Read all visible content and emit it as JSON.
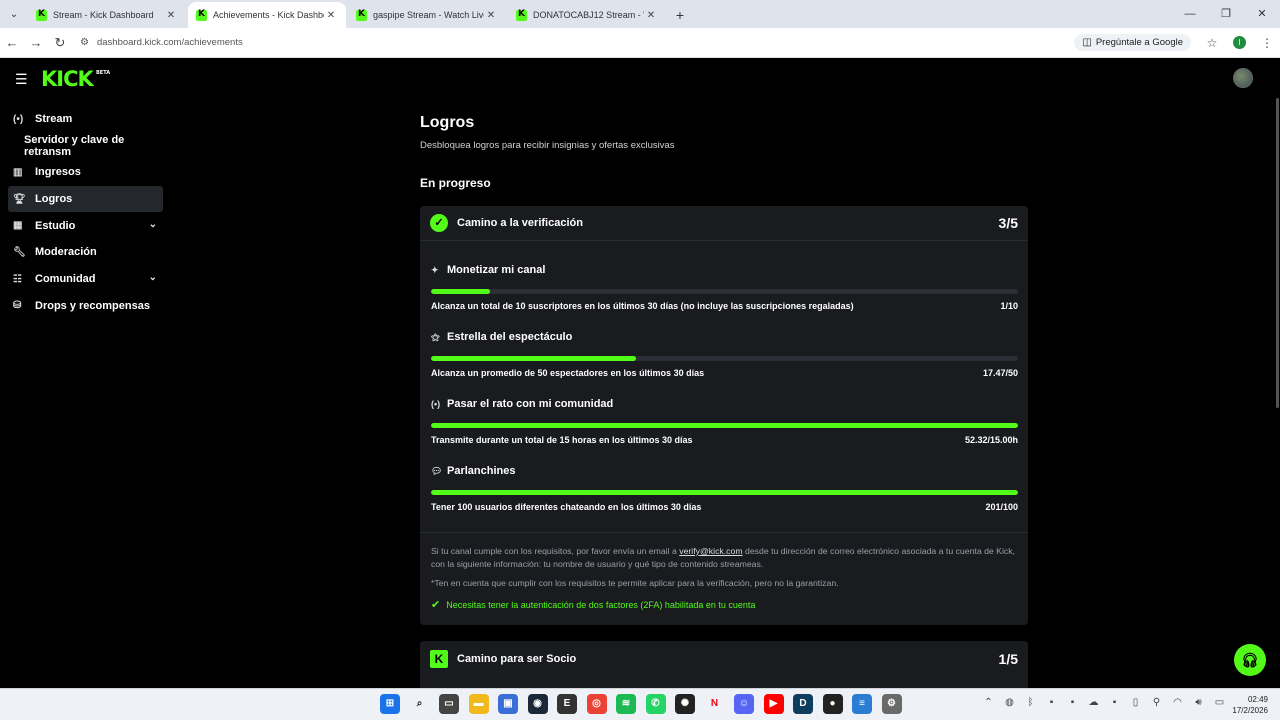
{
  "browser": {
    "tabs": [
      {
        "title": "Stream - Kick Dashboard",
        "active": false
      },
      {
        "title": "Achievements - Kick Dashboard",
        "active": true
      },
      {
        "title": "gaspipe Stream - Watch Live on",
        "active": false
      },
      {
        "title": "DONATOCABJ12 Stream - Watc",
        "active": false
      }
    ],
    "url": "dashboard.kick.com/achievements",
    "ask_google": "Pregúntale a Google",
    "profile_initial": "I"
  },
  "header": {
    "logo": "KICK",
    "logo_badge": "BETA"
  },
  "sidebar": {
    "items": [
      {
        "label": "Stream",
        "icon": "broadcast-icon"
      },
      {
        "label": "Servidor y clave de retransm",
        "icon": ""
      },
      {
        "label": "Ingresos",
        "icon": "chart-icon"
      },
      {
        "label": "Logros",
        "icon": "trophy-icon"
      },
      {
        "label": "Estudio",
        "icon": "studio-icon"
      },
      {
        "label": "Moderación",
        "icon": "wrench-icon"
      },
      {
        "label": "Comunidad",
        "icon": "community-icon"
      },
      {
        "label": "Drops y recompensas",
        "icon": "drops-icon"
      }
    ]
  },
  "main": {
    "title": "Logros",
    "subtitle": "Desbloquea logros para recibir insignias y ofertas exclusivas",
    "section": "En progreso",
    "verification": {
      "title": "Camino a la verificación",
      "count": "3/5",
      "achievements": [
        {
          "title": "Monetizar mi canal",
          "desc": "Alcanza un total de 10 suscriptores en los últimos 30 días (no incluye las suscripciones regaladas)",
          "value": "1/10",
          "progress": 0.1
        },
        {
          "title": "Estrella del espectáculo",
          "desc": "Alcanza un promedio de 50 espectadores en los últimos 30 días",
          "value": "17.47/50",
          "progress": 0.35
        },
        {
          "title": "Pasar el rato con mi comunidad",
          "desc": "Transmite durante un total de 15 horas en los últimos 30 días",
          "value": "52.32/15.00h",
          "progress": 1.0
        },
        {
          "title": "Parlanchines",
          "desc": "Tener 100 usuarios diferentes chateando en los últimos 30 días",
          "value": "201/100",
          "progress": 1.0
        }
      ],
      "note_pre": "Si tu canal cumple con los requisitos, por favor envía un email a",
      "note_email": "verify@kick.com",
      "note_post": "desde tu dirección de correo electrónico asociada a tu cuenta de Kick, con la siguiente información: tu nombre de usuario y qué tipo de contenido streameas.",
      "note2": "*Ten en cuenta que cumplir con los requisitos te permite aplicar para la verificación, pero no la garantizan.",
      "requirement": "Necesitas tener la autenticación de dos factores (2FA) habilitada en tu cuenta"
    },
    "partner": {
      "title": "Camino para ser Socio",
      "count": "1/5"
    }
  },
  "taskbar": {
    "time": "02:49",
    "date": "17/2/2026"
  },
  "colors": {
    "accent": "#53fc18",
    "background": "#000000",
    "card": "#191b1f"
  }
}
